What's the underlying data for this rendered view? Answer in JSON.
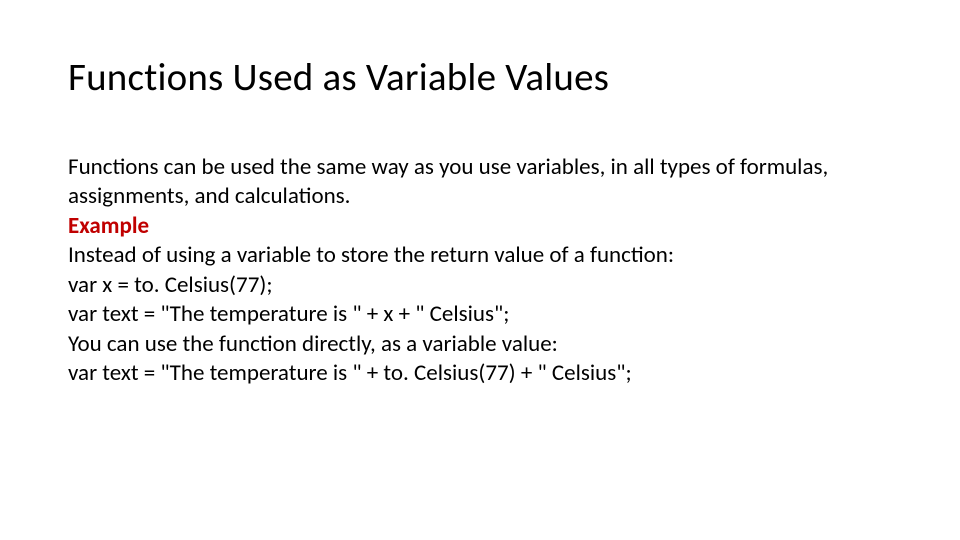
{
  "title": "Functions Used as Variable Values",
  "body": {
    "intro": "Functions can be used the same way as you use variables, in all types of formulas, assignments, and calculations.",
    "example_label": "Example",
    "line1": "Instead of using a variable to store the return value of a function:",
    "code1a": "var x = to. Celsius(77);",
    "code1b": "var text = \"The temperature is \" + x + \" Celsius\";",
    "line2": "You can use the function directly, as a variable value:",
    "code2": "var text = \"The temperature is \" + to. Celsius(77) + \" Celsius\";"
  }
}
